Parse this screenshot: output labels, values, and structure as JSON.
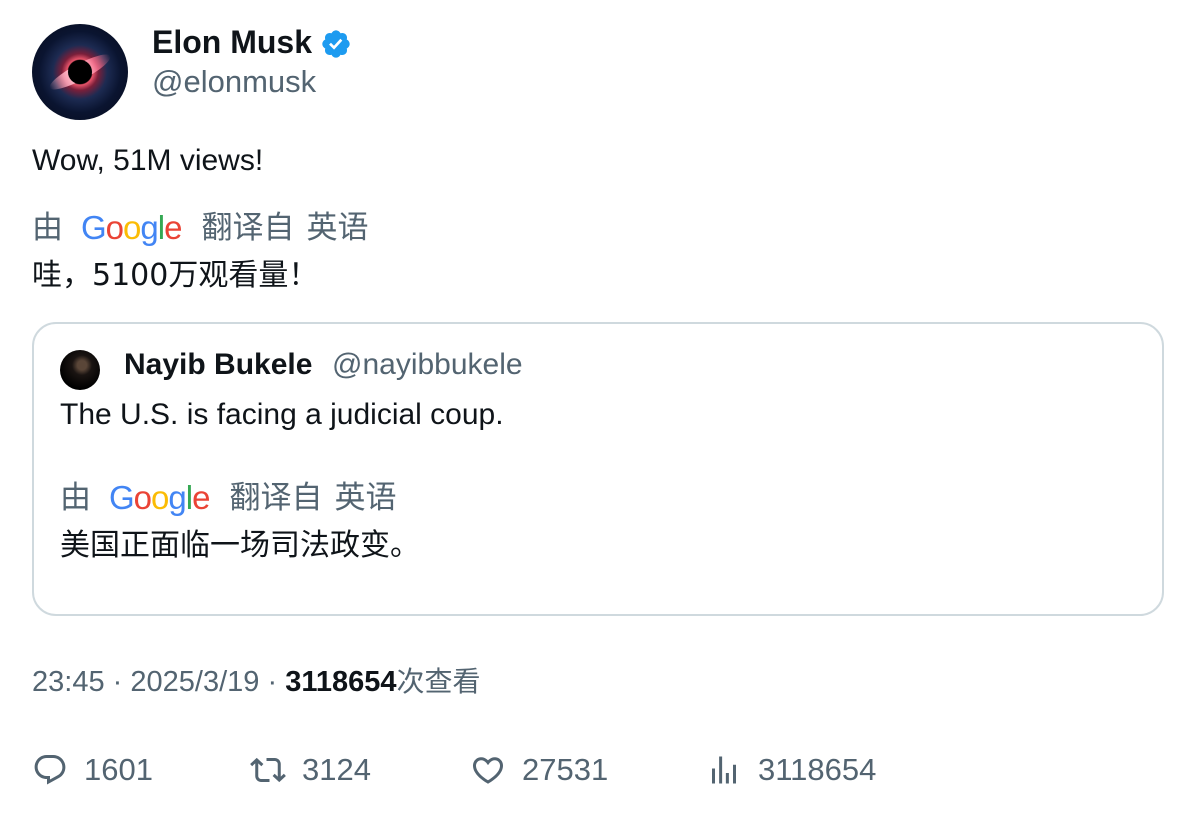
{
  "author": {
    "name": "Elon Musk",
    "handle": "@elonmusk",
    "verified": true
  },
  "tweet": {
    "text": "Wow, 51M views!",
    "translation": {
      "by": "由",
      "provider": "Google",
      "from": "翻译自",
      "language": "英语",
      "text": "哇，5100万观看量！"
    }
  },
  "quote": {
    "name": "Nayib Bukele",
    "handle": "@nayibbukele",
    "text": "The U.S. is facing a judicial coup.",
    "translation": {
      "by": "由",
      "provider": "Google",
      "from": "翻译自",
      "language": "英语",
      "text": "美国正面临一场司法政变。"
    }
  },
  "meta": {
    "time": "23:45",
    "separator": "·",
    "date": "2025/3/19",
    "views": "3118654",
    "views_label": "次查看"
  },
  "actions": {
    "replies": "1601",
    "retweets": "3124",
    "likes": "27531",
    "views": "3118654"
  },
  "icons": {
    "verified": "verified-badge-icon",
    "reply": "reply-icon",
    "retweet": "retweet-icon",
    "like": "heart-icon",
    "views": "bar-chart-icon"
  },
  "colors": {
    "verified": "#1d9bf0",
    "secondary_text": "#536471",
    "primary_text": "#0f1419",
    "border": "#cfd9de"
  }
}
